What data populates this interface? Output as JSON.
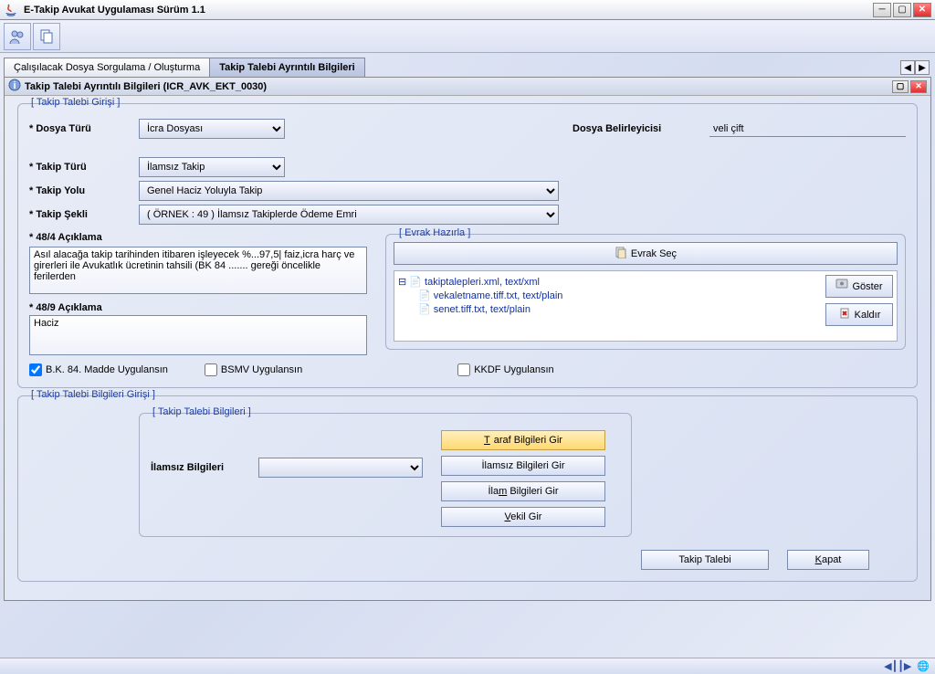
{
  "window": {
    "title": "E-Takip Avukat Uygulaması Sürüm 1.1"
  },
  "tabs": {
    "tab1": "Çalışılacak Dosya Sorgulama / Oluşturma",
    "tab2": "Takip Talebi Ayrıntılı Bilgileri"
  },
  "inner_window": {
    "title": "Takip Talebi Ayrıntılı Bilgileri (ICR_AVK_EKT_0030)"
  },
  "group1": {
    "title": "Takip Talebi Girişi",
    "dosya_turu_label": "* Dosya Türü",
    "dosya_turu_value": "İcra Dosyası",
    "dosya_belirleyicisi_label": "Dosya Belirleyicisi",
    "dosya_belirleyicisi_value": "veli çift",
    "takip_turu_label": "* Takip Türü",
    "takip_turu_value": "İlamsız Takip",
    "takip_yolu_label": "* Takip Yolu",
    "takip_yolu_value": "Genel Haciz Yoluyla Takip",
    "takip_sekli_label": "* Takip Şekli",
    "takip_sekli_value": "( ÖRNEK  : 49 ) İlamsız Takiplerde Ödeme Emri",
    "aciklama_484_label": "* 48/4 Açıklama",
    "aciklama_484_value": "Asıl alacağa takip tarihinden itibaren işleyecek %...97,5| faiz,icra harç ve girerleri ile Avukatlık ücretinin tahsili (BK 84 ....... gereği öncelikle ferilerden",
    "aciklama_489_label": "* 48/9 Açıklama",
    "aciklama_489_value": "Haciz",
    "chk_bk84": "B.K. 84. Madde Uygulansın",
    "chk_bsmv": "BSMV Uygulansın",
    "chk_kkdf": "KKDF Uygulansın"
  },
  "evrak": {
    "title": "Evrak Hazırla",
    "evrak_sec": "Evrak Seç",
    "tree_root": "takiptalepleri.xml, text/xml",
    "tree_child1": "vekaletname.tiff.txt, text/plain",
    "tree_child2": "senet.tiff.txt, text/plain",
    "goster": "Göster",
    "kaldir": "Kaldır"
  },
  "group2": {
    "title": "Takip Talebi Bilgileri Girişi",
    "inner_title": "Takip Talebi Bilgileri",
    "ilamsiz_bilgileri_label": "İlamsız Bilgileri",
    "btn_taraf": "Taraf Bilgileri Gir",
    "btn_ilamsiz": "İlamsız Bilgileri Gir",
    "btn_ilam": "İlam Bilgileri Gir",
    "btn_vekil": "Vekil Gir"
  },
  "bottom": {
    "takip_talebi": "Takip Talebi",
    "kapat": "Kapat"
  }
}
